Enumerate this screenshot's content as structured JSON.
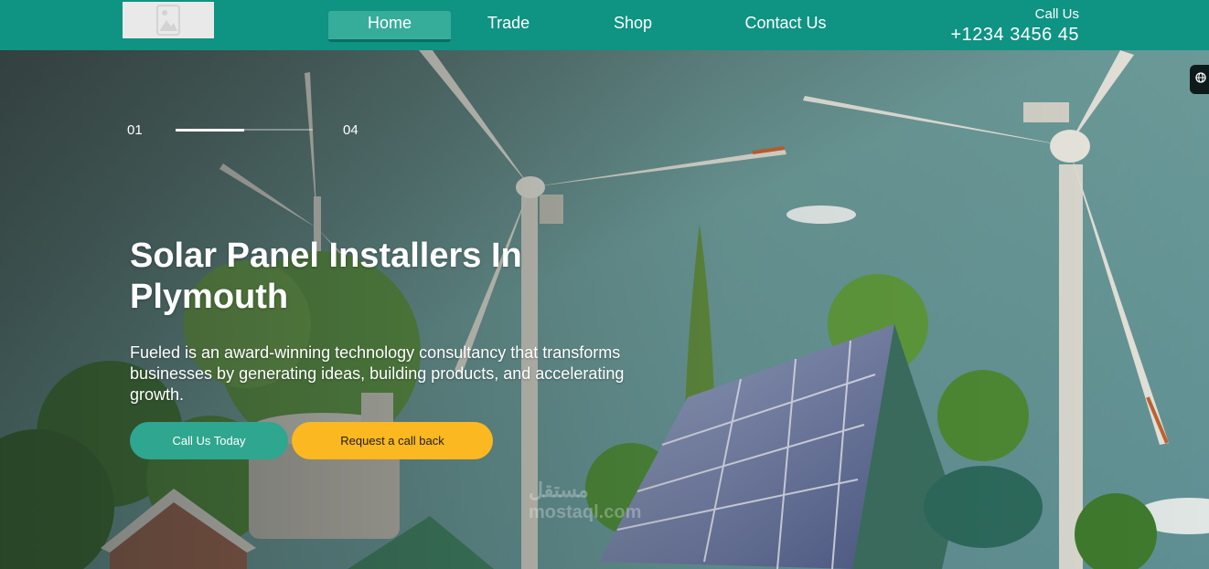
{
  "header": {
    "logo_icon": "image-placeholder-icon",
    "nav": [
      {
        "label": "Home",
        "active": true
      },
      {
        "label": "Trade",
        "active": false
      },
      {
        "label": "Shop",
        "active": false
      },
      {
        "label": "Contact Us",
        "active": false
      }
    ],
    "call_label": "Call Us",
    "call_number": "+1234 3456 45"
  },
  "hero": {
    "slider": {
      "current": "01",
      "total": "04",
      "progress": 0.5
    },
    "title": "Solar Panel Installers In Plymouth",
    "description": "Fueled is an award-winning technology consultancy that transforms businesses by generating ideas, building products, and accelerating growth.",
    "primary_button": "Call Us Today",
    "secondary_button": "Request a call back"
  },
  "side_widget": {
    "icon": "globe-icon"
  },
  "watermark": {
    "line1": "مستقل",
    "line2": "mostaql.com"
  },
  "colors": {
    "header_bg": "#0f9383",
    "nav_active": "#36ad9b",
    "primary_button": "#2fa68f",
    "secondary_button": "#fbb820"
  }
}
